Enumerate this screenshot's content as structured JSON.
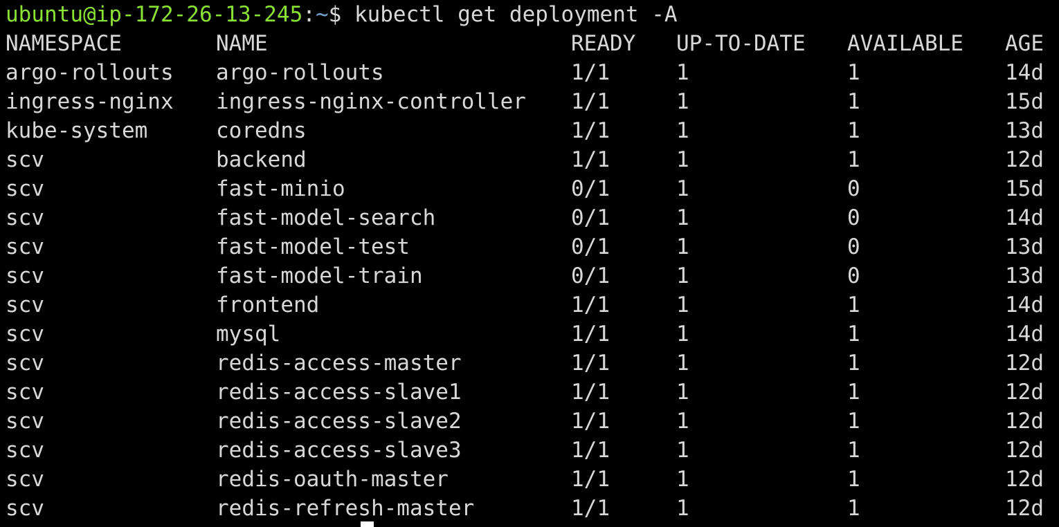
{
  "prompt": {
    "user_host": "ubuntu@ip-172-26-13-245",
    "separator": ":",
    "path": "~",
    "sigil": "$ ",
    "command": "kubectl get deployment -A"
  },
  "table": {
    "headers": {
      "namespace": "NAMESPACE",
      "name": "NAME",
      "ready": "READY",
      "up_to_date": "UP-TO-DATE",
      "available": "AVAILABLE",
      "age": "AGE"
    },
    "rows": [
      {
        "namespace": "argo-rollouts",
        "name": "argo-rollouts",
        "ready": "1/1",
        "up_to_date": "1",
        "available": "1",
        "age": "14d"
      },
      {
        "namespace": "ingress-nginx",
        "name": "ingress-nginx-controller",
        "ready": "1/1",
        "up_to_date": "1",
        "available": "1",
        "age": "15d"
      },
      {
        "namespace": "kube-system",
        "name": "coredns",
        "ready": "1/1",
        "up_to_date": "1",
        "available": "1",
        "age": "13d"
      },
      {
        "namespace": "scv",
        "name": "backend",
        "ready": "1/1",
        "up_to_date": "1",
        "available": "1",
        "age": "12d"
      },
      {
        "namespace": "scv",
        "name": "fast-minio",
        "ready": "0/1",
        "up_to_date": "1",
        "available": "0",
        "age": "15d"
      },
      {
        "namespace": "scv",
        "name": "fast-model-search",
        "ready": "0/1",
        "up_to_date": "1",
        "available": "0",
        "age": "14d"
      },
      {
        "namespace": "scv",
        "name": "fast-model-test",
        "ready": "0/1",
        "up_to_date": "1",
        "available": "0",
        "age": "13d"
      },
      {
        "namespace": "scv",
        "name": "fast-model-train",
        "ready": "0/1",
        "up_to_date": "1",
        "available": "0",
        "age": "13d"
      },
      {
        "namespace": "scv",
        "name": "frontend",
        "ready": "1/1",
        "up_to_date": "1",
        "available": "1",
        "age": "14d"
      },
      {
        "namespace": "scv",
        "name": "mysql",
        "ready": "1/1",
        "up_to_date": "1",
        "available": "1",
        "age": "14d"
      },
      {
        "namespace": "scv",
        "name": "redis-access-master",
        "ready": "1/1",
        "up_to_date": "1",
        "available": "1",
        "age": "12d"
      },
      {
        "namespace": "scv",
        "name": "redis-access-slave1",
        "ready": "1/1",
        "up_to_date": "1",
        "available": "1",
        "age": "12d"
      },
      {
        "namespace": "scv",
        "name": "redis-access-slave2",
        "ready": "1/1",
        "up_to_date": "1",
        "available": "1",
        "age": "12d"
      },
      {
        "namespace": "scv",
        "name": "redis-access-slave3",
        "ready": "1/1",
        "up_to_date": "1",
        "available": "1",
        "age": "12d"
      },
      {
        "namespace": "scv",
        "name": "redis-oauth-master",
        "ready": "1/1",
        "up_to_date": "1",
        "available": "1",
        "age": "12d"
      },
      {
        "namespace": "scv",
        "name": "redis-refresh-master",
        "ready": "1/1",
        "up_to_date": "1",
        "available": "1",
        "age": "12d"
      }
    ]
  },
  "colors": {
    "background": "#000000",
    "foreground": "#d8d8d8",
    "prompt_user": "#8ae234",
    "prompt_path": "#729fcf"
  }
}
